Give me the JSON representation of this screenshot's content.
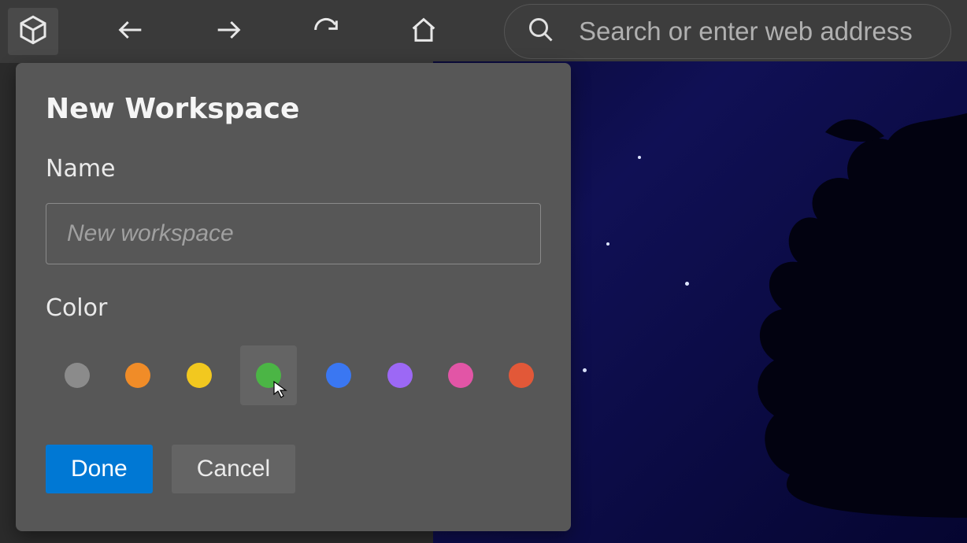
{
  "toolbar": {
    "search_placeholder": "Search or enter web address"
  },
  "popup": {
    "title": "New Workspace",
    "name_label": "Name",
    "name_placeholder": "New workspace",
    "name_value": "",
    "color_label": "Color",
    "colors": [
      {
        "name": "gray",
        "hex": "#8b8b8b",
        "selected": false
      },
      {
        "name": "orange",
        "hex": "#f08c28",
        "selected": false
      },
      {
        "name": "yellow",
        "hex": "#f2c81f",
        "selected": false
      },
      {
        "name": "green",
        "hex": "#4bb545",
        "selected": true
      },
      {
        "name": "blue",
        "hex": "#3a77f2",
        "selected": false
      },
      {
        "name": "purple",
        "hex": "#9c68f5",
        "selected": false
      },
      {
        "name": "pink",
        "hex": "#e255a6",
        "selected": false
      },
      {
        "name": "red",
        "hex": "#e25838",
        "selected": false
      }
    ],
    "done_label": "Done",
    "cancel_label": "Cancel"
  }
}
